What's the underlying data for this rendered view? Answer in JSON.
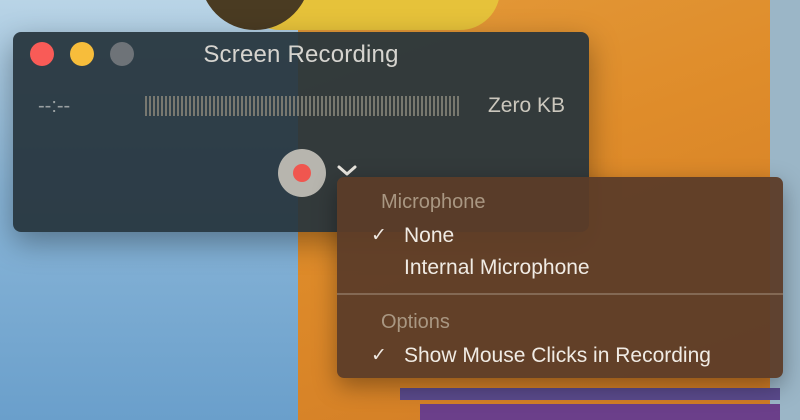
{
  "window": {
    "title": "Screen Recording",
    "elapsed_time": "--:--",
    "file_size": "Zero KB"
  },
  "menu": {
    "microphone_header": "Microphone",
    "microphone_options": [
      {
        "label": "None",
        "checked": true,
        "check_glyph": "✓"
      },
      {
        "label": "Internal Microphone",
        "checked": false,
        "check_glyph": ""
      }
    ],
    "options_header": "Options",
    "options_items": [
      {
        "label": "Show Mouse Clicks in Recording",
        "checked": true,
        "check_glyph": "✓"
      }
    ]
  },
  "colors": {
    "close": "#f95b57",
    "minimize": "#f7bd3b",
    "zoom": "#6e7378",
    "record_dot": "#f0564f"
  },
  "icons": {
    "record": "record-icon",
    "chevron": "chevron-down-icon",
    "check": "checkmark-icon"
  }
}
